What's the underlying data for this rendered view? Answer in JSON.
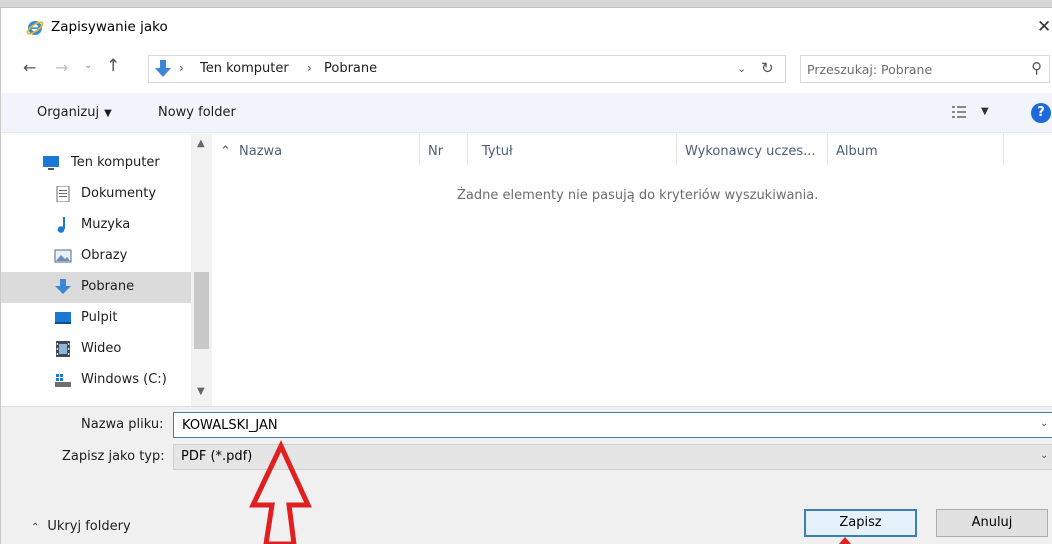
{
  "window": {
    "title": "Zapisywanie jako",
    "close_glyph": "✕"
  },
  "address": {
    "crumbs": [
      "Ten komputer",
      "Pobrane"
    ],
    "search_placeholder": "Przeszukaj: Pobrane"
  },
  "toolbar": {
    "organize_label": "Organizuj",
    "new_folder_label": "Nowy folder",
    "help_label": "?"
  },
  "sidebar": {
    "items": [
      {
        "label": "Ten komputer",
        "icon": "computer-icon"
      },
      {
        "label": "Dokumenty",
        "icon": "documents-icon"
      },
      {
        "label": "Muzyka",
        "icon": "music-icon"
      },
      {
        "label": "Obrazy",
        "icon": "pictures-icon"
      },
      {
        "label": "Pobrane",
        "icon": "downloads-icon",
        "selected": true
      },
      {
        "label": "Pulpit",
        "icon": "desktop-icon"
      },
      {
        "label": "Wideo",
        "icon": "video-icon"
      },
      {
        "label": "Windows (C:)",
        "icon": "drive-icon"
      }
    ]
  },
  "filelist": {
    "columns": [
      "Nazwa",
      "Nr",
      "Tytuł",
      "Wykonawcy uczes...",
      "Album"
    ],
    "empty_message": "Żadne elementy nie pasują do kryteriów wyszukiwania."
  },
  "form": {
    "filename_label": "Nazwa pliku:",
    "filename_value": "KOWALSKI_JAN",
    "filetype_label": "Zapisz jako typ:",
    "filetype_value": "PDF (*.pdf)"
  },
  "footer": {
    "hide_folders_label": "Ukryj foldery",
    "save_label": "Zapisz",
    "cancel_label": "Anuluj"
  },
  "colors": {
    "accent": "#3c7fb1",
    "annotation_arrow": "#e02020"
  }
}
